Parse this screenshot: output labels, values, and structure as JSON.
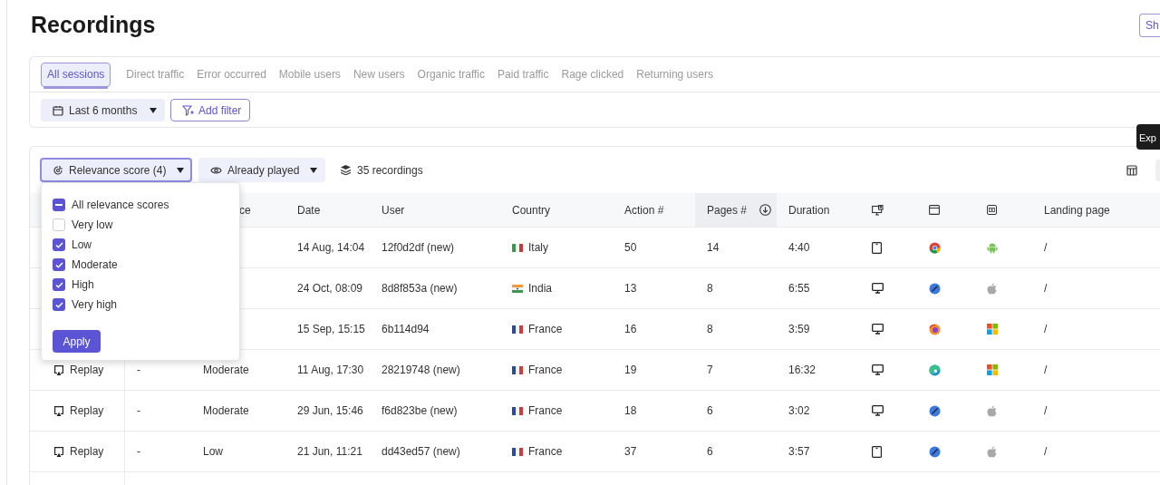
{
  "page": {
    "title": "Recordings",
    "share_button": "Sh"
  },
  "segments": {
    "tabs": [
      {
        "label": "All sessions",
        "selected": true
      },
      {
        "label": "Direct traffic",
        "selected": false
      },
      {
        "label": "Error occurred",
        "selected": false
      },
      {
        "label": "Mobile users",
        "selected": false
      },
      {
        "label": "New users",
        "selected": false
      },
      {
        "label": "Organic traffic",
        "selected": false
      },
      {
        "label": "Paid traffic",
        "selected": false
      },
      {
        "label": "Rage clicked",
        "selected": false
      },
      {
        "label": "Returning users",
        "selected": false
      }
    ]
  },
  "filters": {
    "date_range": "Last 6 months",
    "add_filter": "Add filter"
  },
  "toolbar": {
    "relevance_filter": "Relevance score (4)",
    "played_filter": "Already played",
    "count": "35 recordings",
    "tooltip": "Exp"
  },
  "relevance_menu": {
    "all_option": {
      "label": "All relevance scores",
      "indeterminate": true
    },
    "options": [
      {
        "label": "Very low",
        "checked": false
      },
      {
        "label": "Low",
        "checked": true
      },
      {
        "label": "Moderate",
        "checked": true
      },
      {
        "label": "High",
        "checked": true
      },
      {
        "label": "Very high",
        "checked": true
      }
    ],
    "apply": "Apply"
  },
  "table": {
    "columns": [
      {
        "kind": "text",
        "label": "ce",
        "sorted": false
      },
      {
        "kind": "text",
        "label": "Date",
        "sorted": false
      },
      {
        "kind": "text",
        "label": "User",
        "sorted": false
      },
      {
        "kind": "text",
        "label": "Country",
        "sorted": false
      },
      {
        "kind": "text",
        "label": "Action #",
        "sorted": false
      },
      {
        "kind": "text",
        "label": "Pages #",
        "sorted": true
      },
      {
        "kind": "text",
        "label": "Duration",
        "sorted": false
      },
      {
        "kind": "device",
        "sorted": false
      },
      {
        "kind": "browser",
        "sorted": false
      },
      {
        "kind": "os",
        "sorted": false
      },
      {
        "kind": "text",
        "label": "Landing page",
        "sorted": false
      }
    ],
    "rows": [
      {
        "date": "14 Aug, 14:04",
        "user": "12f0d2df (new)",
        "flag": {
          "kind": "italy"
        },
        "country": "Italy",
        "actions": "50",
        "pages": "14",
        "duration": "4:40",
        "device": {
          "kind": "tablet"
        },
        "browser": {
          "kind": "chrome"
        },
        "os": {
          "kind": "android"
        },
        "landing_page": "/"
      },
      {
        "date": "24 Oct, 08:09",
        "user": "8d8f853a (new)",
        "flag": {
          "kind": "india"
        },
        "country": "India",
        "actions": "13",
        "pages": "8",
        "duration": "6:55",
        "device": {
          "kind": "desktop"
        },
        "browser": {
          "kind": "safari"
        },
        "os": {
          "kind": "apple"
        },
        "landing_page": "/"
      },
      {
        "date": "15 Sep, 15:15",
        "user": "6b114d94",
        "flag": {
          "kind": "france"
        },
        "country": "France",
        "actions": "16",
        "pages": "8",
        "duration": "3:59",
        "device": {
          "kind": "desktop"
        },
        "browser": {
          "kind": "firefox"
        },
        "os": {
          "kind": "windows"
        },
        "landing_page": "/"
      },
      {
        "replay": "Replay",
        "score": "-",
        "relevance": "Moderate",
        "date": "11 Aug, 17:30",
        "user": "28219748 (new)",
        "flag": {
          "kind": "france"
        },
        "country": "France",
        "actions": "19",
        "pages": "7",
        "duration": "16:32",
        "device": {
          "kind": "desktop"
        },
        "browser": {
          "kind": "edge"
        },
        "os": {
          "kind": "windows"
        },
        "landing_page": "/"
      },
      {
        "replay": "Replay",
        "score": "-",
        "relevance": "Moderate",
        "date": "29 Jun, 15:46",
        "user": "f6d823be (new)",
        "flag": {
          "kind": "france"
        },
        "country": "France",
        "actions": "18",
        "pages": "6",
        "duration": "3:02",
        "device": {
          "kind": "desktop"
        },
        "browser": {
          "kind": "safari"
        },
        "os": {
          "kind": "apple"
        },
        "landing_page": "/"
      },
      {
        "replay": "Replay",
        "score": "-",
        "relevance": "Low",
        "date": "21 Jun, 11:21",
        "user": "dd43ed57 (new)",
        "flag": {
          "kind": "france"
        },
        "country": "France",
        "actions": "37",
        "pages": "6",
        "duration": "3:57",
        "device": {
          "kind": "tablet"
        },
        "browser": {
          "kind": "safari"
        },
        "os": {
          "kind": "apple"
        },
        "landing_page": "/"
      }
    ]
  }
}
